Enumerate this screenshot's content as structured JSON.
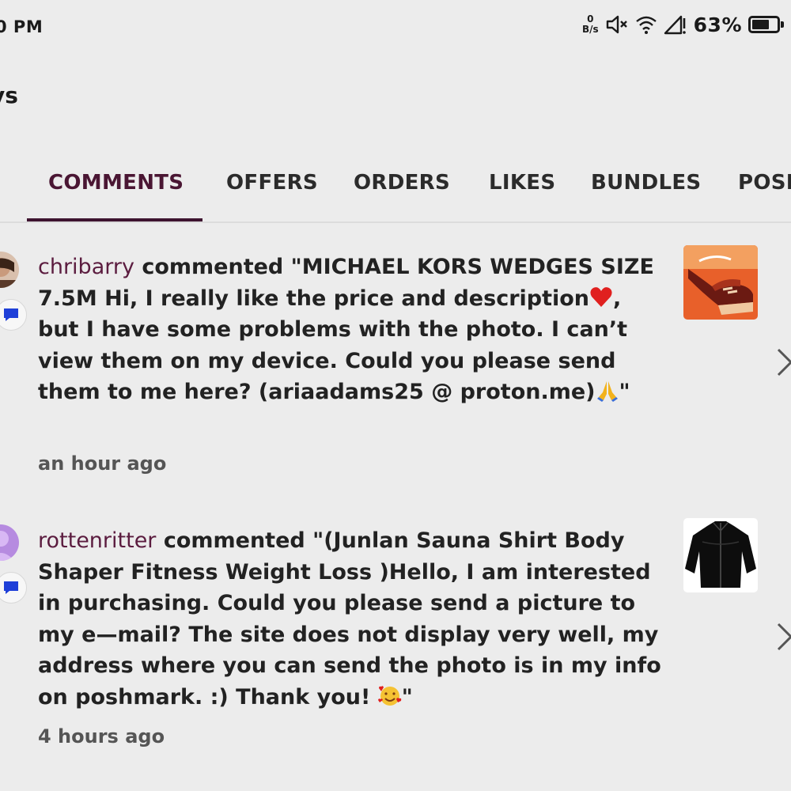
{
  "status_bar": {
    "time": "0 PM",
    "net_speed_value": "0",
    "net_speed_unit": "B/s",
    "battery_percent": "63%",
    "battery_level": 0.63,
    "icons": [
      "mute-icon",
      "wifi-icon",
      "cell-signal-icon",
      "battery-icon"
    ]
  },
  "header": {
    "title": "ys"
  },
  "tabs": [
    {
      "label": "COMMENTS",
      "active": true
    },
    {
      "label": "OFFERS",
      "active": false
    },
    {
      "label": "ORDERS",
      "active": false
    },
    {
      "label": "LIKES",
      "active": false
    },
    {
      "label": "BUNDLES",
      "active": false
    },
    {
      "label": "POSH",
      "active": false
    }
  ],
  "notifications": [
    {
      "username": "chribarry",
      "text_before_emoji_1": " commented \"MICHAEL KORS WEDGES SIZE 7.5M Hi, I really like the price and description",
      "emoji_1": "red-heart-emoji",
      "text_between": ", but I have some problems with the photo. I can’t view them on my device. Could you please send them to me here? (ariaadams25 @ proton.me)",
      "emoji_2": "folded-hands-emoji",
      "text_end": "\"",
      "time": "an hour ago",
      "thumbnail": "red-wedge-shoes-thumbnail"
    },
    {
      "username": "rottenritter",
      "text_before_emoji": " commented \"(Junlan Sauna Shirt Body Shaper Fitness Weight Loss )Hello, I am interested in purchasing. Could you please send a picture to my e—mail? The site does not display very well, my address where you can send the photo is in my info on poshmark. :) Thank you! ",
      "emoji": "smiling-face-with-hearts-emoji",
      "text_end": "\"",
      "time": "4 hours ago",
      "thumbnail": "black-sauna-jacket-thumbnail"
    }
  ],
  "colors": {
    "background": "#ececec",
    "username": "#5b1c3f",
    "active_tab": "#4a1633",
    "indicator": "#3e1430",
    "badge_blue": "#1e3fd8"
  }
}
